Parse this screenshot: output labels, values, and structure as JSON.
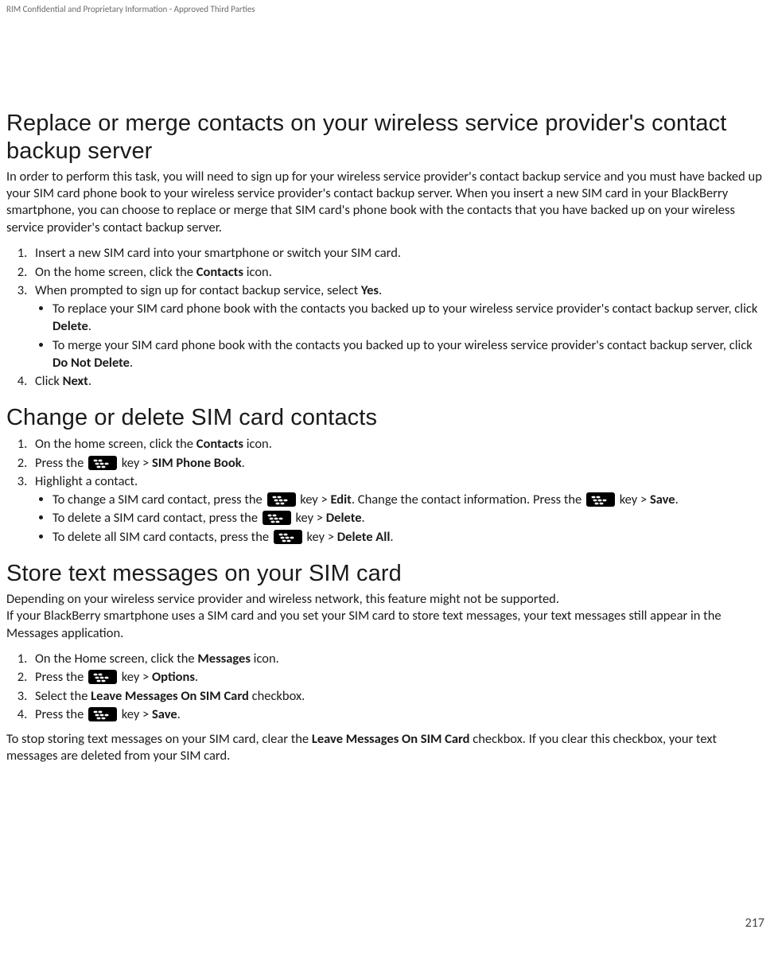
{
  "header": {
    "confidential": "RIM Confidential and Proprietary Information - Approved Third Parties"
  },
  "page_number": "217",
  "icon": {
    "bb_key_name": "blackberry-menu-key-icon"
  },
  "sections": {
    "replace_merge": {
      "title": "Replace or merge contacts on your wireless service provider's contact backup server",
      "intro": "In order to perform this task, you will need to sign up for your wireless service provider's contact backup service and you must have backed up your SIM card phone book to your wireless service provider's contact backup server. When you insert a new SIM card in your BlackBerry smartphone, you can choose to replace or merge that SIM card's phone book with the contacts that you have backed up on your wireless service provider's contact backup server.",
      "steps": {
        "s1": "Insert a new SIM card into your smartphone or switch your SIM card.",
        "s2_a": "On the home screen, click the ",
        "s2_b": "Contacts",
        "s2_c": " icon.",
        "s3_a": "When prompted to sign up for contact backup service, select ",
        "s3_b": "Yes",
        "s3_c": ".",
        "s3_sub1_a": "To replace your SIM card phone book with the contacts you backed up to your wireless service provider's contact backup server, click ",
        "s3_sub1_b": "Delete",
        "s3_sub1_c": ".",
        "s3_sub2_a": "To merge your SIM card phone book with the contacts you backed up to your wireless service provider's contact backup server, click ",
        "s3_sub2_b": "Do Not Delete",
        "s3_sub2_c": ".",
        "s4_a": "Click ",
        "s4_b": "Next",
        "s4_c": "."
      }
    },
    "change_delete": {
      "title": "Change or delete SIM card contacts",
      "steps": {
        "s1_a": "On the home screen, click the ",
        "s1_b": "Contacts",
        "s1_c": " icon.",
        "s2_a": "Press the ",
        "s2_b": " key > ",
        "s2_c": "SIM Phone Book",
        "s2_d": ".",
        "s3": "Highlight a contact.",
        "s3_sub1_a": "To change a SIM card contact, press the ",
        "s3_sub1_b": " key > ",
        "s3_sub1_c": "Edit",
        "s3_sub1_d": ". Change the contact information. Press the ",
        "s3_sub1_e": " key > ",
        "s3_sub1_f": "Save",
        "s3_sub1_g": ".",
        "s3_sub2_a": "To delete a SIM card contact, press the ",
        "s3_sub2_b": " key > ",
        "s3_sub2_c": "Delete",
        "s3_sub2_d": ".",
        "s3_sub3_a": "To delete all SIM card contacts, press the ",
        "s3_sub3_b": " key > ",
        "s3_sub3_c": "Delete All",
        "s3_sub3_d": "."
      }
    },
    "store_text": {
      "title": "Store text messages on your SIM card",
      "intro1": "Depending on your wireless service provider and wireless network, this feature might not be supported.",
      "intro2": "If your BlackBerry smartphone uses a SIM card and you set your SIM card to store text messages, your text messages still appear in the Messages application.",
      "steps": {
        "s1_a": "On the Home screen, click the ",
        "s1_b": "Messages",
        "s1_c": " icon.",
        "s2_a": "Press the ",
        "s2_b": " key > ",
        "s2_c": "Options",
        "s2_d": ".",
        "s3_a": "Select the ",
        "s3_b": "Leave Messages On SIM Card",
        "s3_c": " checkbox.",
        "s4_a": "Press the ",
        "s4_b": " key > ",
        "s4_c": "Save",
        "s4_d": "."
      },
      "outro_a": "To stop storing text messages on your SIM card, clear the ",
      "outro_b": "Leave Messages On SIM Card",
      "outro_c": " checkbox. If you clear this checkbox, your text messages are deleted from your SIM card."
    }
  }
}
